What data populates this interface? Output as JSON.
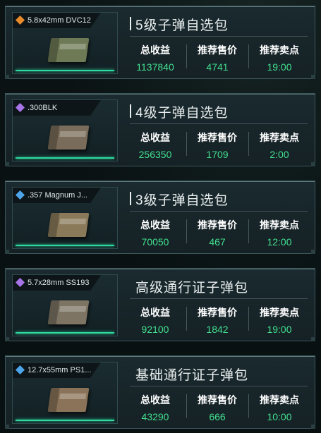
{
  "labels": {
    "total": "总收益",
    "price": "推荐售价",
    "time": "推荐卖点"
  },
  "cards": [
    {
      "ammo": "5.8x42mm DVC12",
      "title": "5级子弹自选包",
      "total": "1137840",
      "price": "4741",
      "time": "19:00",
      "rarity_icon": "orange-rarity-icon",
      "rarity_color": "#e88a2a",
      "box_color": "#6e7a55"
    },
    {
      "ammo": ".300BLK",
      "title": "4级子弹自选包",
      "total": "256350",
      "price": "1709",
      "time": "2:00",
      "rarity_icon": "purple-rarity-icon",
      "rarity_color": "#a774e8",
      "box_color": "#7a6c5a"
    },
    {
      "ammo": ".357 Magnum J...",
      "title": "3级子弹自选包",
      "total": "70050",
      "price": "467",
      "time": "12:00",
      "rarity_icon": "blue-rarity-icon",
      "rarity_color": "#4ea4e8",
      "box_color": "#8a7a5a"
    },
    {
      "ammo": "5.7x28mm SS193",
      "title": "高级通行证子弹包",
      "total": "92100",
      "price": "1842",
      "time": "19:00",
      "rarity_icon": "purple-rarity-icon",
      "rarity_color": "#a774e8",
      "box_color": "#7d7464"
    },
    {
      "ammo": "12.7x55mm PS1...",
      "title": "基础通行证子弹包",
      "total": "43290",
      "price": "666",
      "time": "10:00",
      "rarity_icon": "blue-rarity-icon",
      "rarity_color": "#4ea4e8",
      "box_color": "#8a7358"
    }
  ]
}
